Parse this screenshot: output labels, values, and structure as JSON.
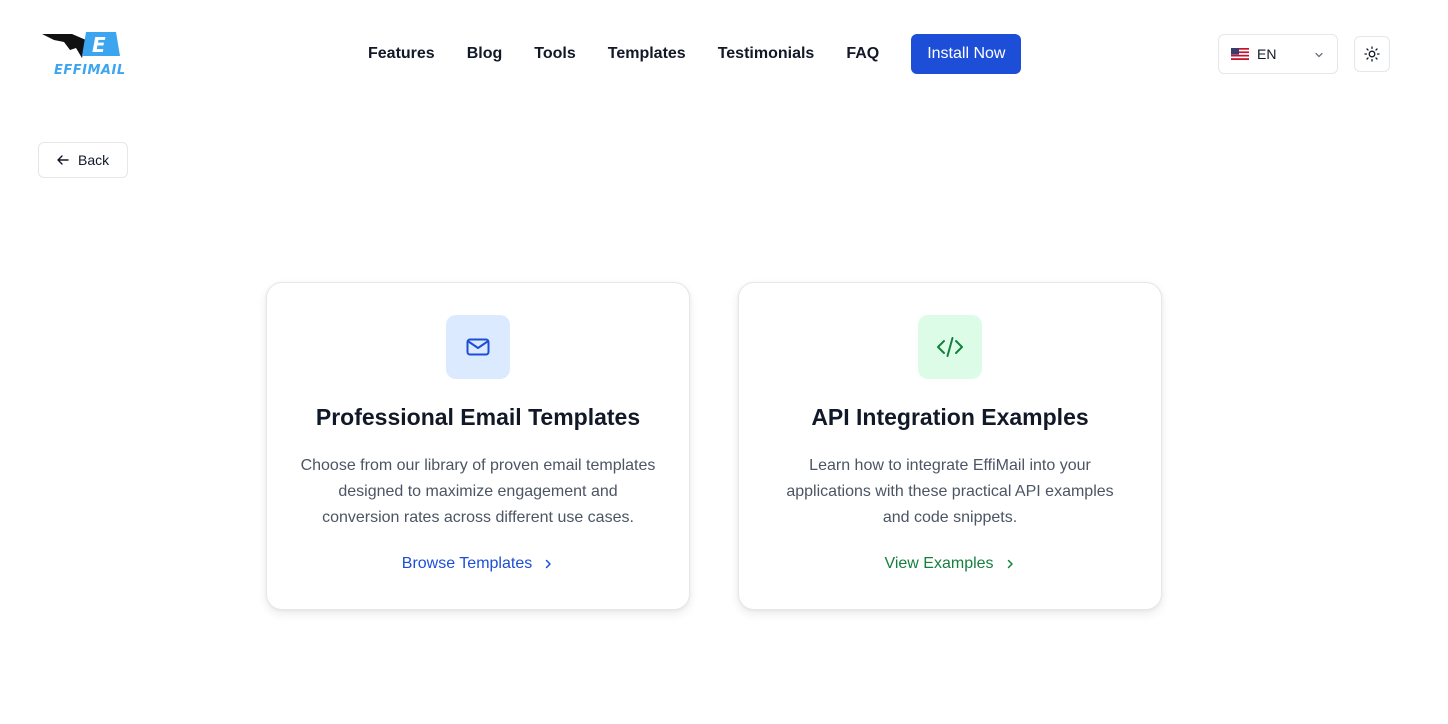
{
  "brand": {
    "name": "EFFIMAIL",
    "logo_letter": "E",
    "accent": "#3ba5f0"
  },
  "nav": {
    "links": [
      "Features",
      "Blog",
      "Tools",
      "Templates",
      "Testimonials",
      "FAQ"
    ],
    "install_label": "Install Now",
    "install_color": "#1d4ed8"
  },
  "language": {
    "code": "EN",
    "flag_icon": "us-flag-icon"
  },
  "theme_toggle": {
    "icon": "sun-icon"
  },
  "back": {
    "label": "Back",
    "icon": "arrow-left-icon"
  },
  "cards": [
    {
      "icon": "mail-icon",
      "title": "Professional Email Templates",
      "description": "Choose from our library of proven email templates designed to maximize engagement and conversion rates across different use cases.",
      "link_label": "Browse Templates",
      "color": "#1d4ed8"
    },
    {
      "icon": "code-icon",
      "title": "API Integration Examples",
      "description": "Learn how to integrate EffiMail into your applications with these practical API examples and code snippets.",
      "link_label": "View Examples",
      "color": "#15803d"
    }
  ]
}
